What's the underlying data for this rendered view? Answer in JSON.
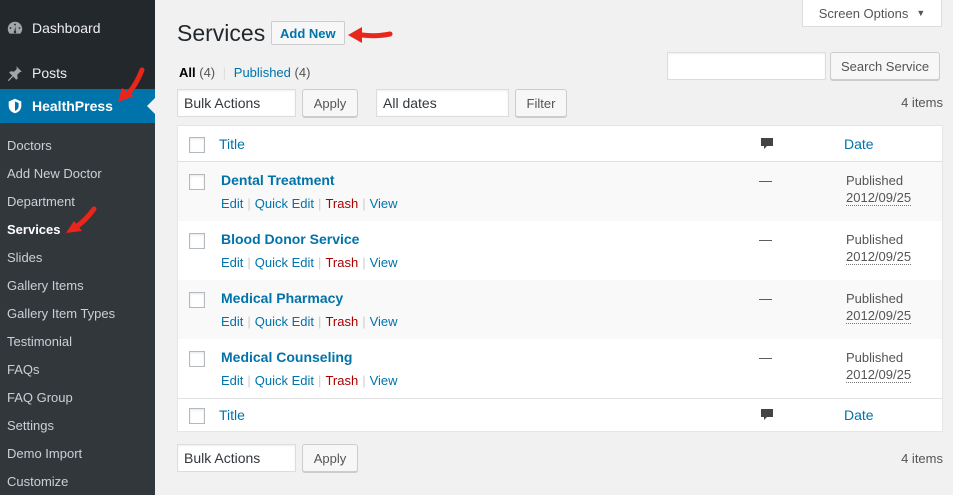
{
  "sidebar": {
    "top_items": [
      {
        "label": "Dashboard",
        "icon": "dashboard-icon"
      },
      {
        "label": "Posts",
        "icon": "pin-icon"
      },
      {
        "label": "HealthPress",
        "icon": "shield-icon"
      }
    ],
    "submenu": [
      "Doctors",
      "Add New Doctor",
      "Department",
      "Services",
      "Slides",
      "Gallery Items",
      "Gallery Item Types",
      "Testimonial",
      "FAQs",
      "FAQ Group",
      "Settings",
      "Demo Import",
      "Customize"
    ]
  },
  "header": {
    "title": "Services",
    "add_new_label": "Add New",
    "screen_options_label": "Screen Options"
  },
  "filters": {
    "all_label": "All",
    "all_count": "(4)",
    "separator": "|",
    "published_label": "Published",
    "published_count": "(4)"
  },
  "search": {
    "button_label": "Search Service",
    "value": ""
  },
  "bulk_top": {
    "select_value": "Bulk Actions",
    "apply_label": "Apply",
    "dates_value": "All dates",
    "filter_label": "Filter",
    "items_count": "4 items"
  },
  "bulk_bottom": {
    "select_value": "Bulk Actions",
    "apply_label": "Apply",
    "items_count": "4 items"
  },
  "table": {
    "columns": {
      "title": "Title",
      "date": "Date"
    },
    "row_actions": {
      "edit": "Edit",
      "quick_edit": "Quick Edit",
      "trash": "Trash",
      "view": "View",
      "sep": "|"
    },
    "rows": [
      {
        "title": "Dental Treatment",
        "comments": "—",
        "status": "Published",
        "date": "2012/09/25"
      },
      {
        "title": "Blood Donor Service",
        "comments": "—",
        "status": "Published",
        "date": "2012/09/25"
      },
      {
        "title": "Medical Pharmacy",
        "comments": "—",
        "status": "Published",
        "date": "2012/09/25"
      },
      {
        "title": "Medical Counseling",
        "comments": "—",
        "status": "Published",
        "date": "2012/09/25"
      }
    ]
  },
  "colors": {
    "sidebar_bg": "#23282d",
    "submenu_bg": "#32373c",
    "accent": "#0073aa",
    "trash": "#a00",
    "arrow": "#e8261b"
  }
}
